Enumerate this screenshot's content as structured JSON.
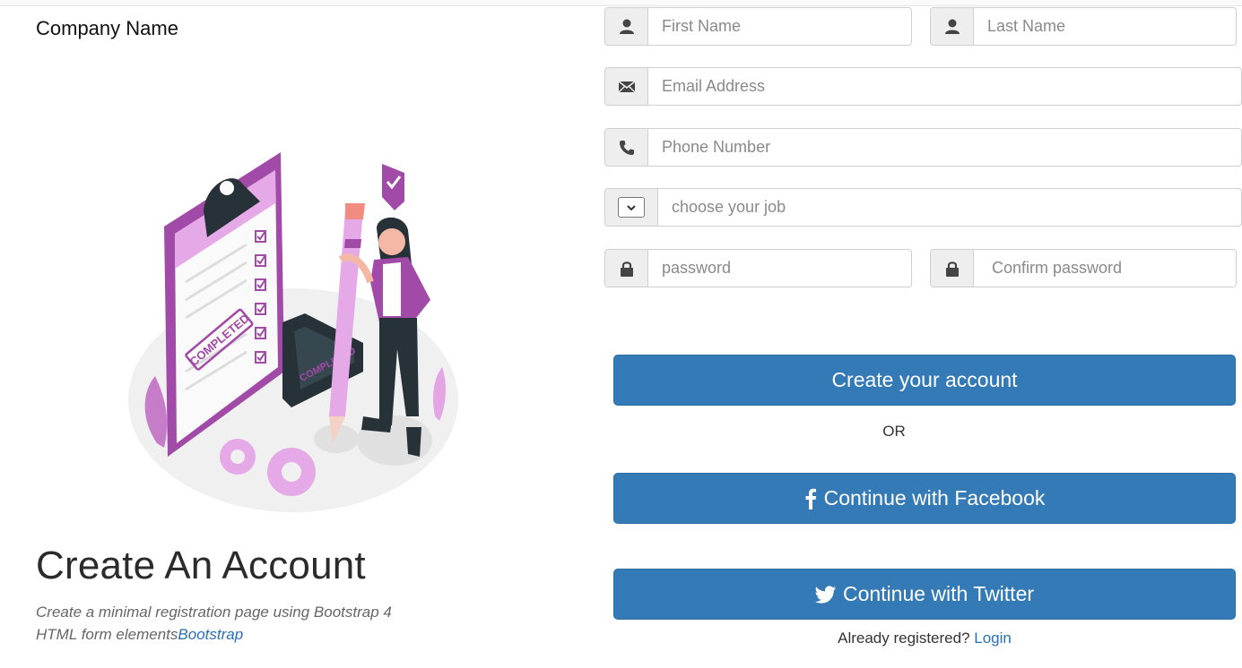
{
  "brand": {
    "name": "Company Name"
  },
  "hero": {
    "title": "Create An Account",
    "subtitle": "Create a minimal registration page using Bootstrap 4 HTML form elements",
    "link_text": "Bootstrap",
    "illustration": {
      "stamp_text": "COMPLETED",
      "stamp_text_2": "COMPLETED"
    }
  },
  "form": {
    "first_name": {
      "placeholder": "First Name",
      "value": "",
      "icon": "user-icon"
    },
    "last_name": {
      "placeholder": "Last Name",
      "value": "",
      "icon": "user-icon"
    },
    "email": {
      "placeholder": "Email Address",
      "value": "",
      "icon": "envelope-icon"
    },
    "phone": {
      "placeholder": "Phone Number",
      "value": "",
      "icon": "phone-icon"
    },
    "job": {
      "placeholder": "choose your job",
      "value": "",
      "icon": "chevron-down-icon"
    },
    "password": {
      "placeholder": "password",
      "value": "",
      "icon": "lock-icon"
    },
    "confirm_password": {
      "placeholder": "Confirm password",
      "value": "",
      "icon": "lock-icon"
    }
  },
  "actions": {
    "create_label": "Create your account",
    "or_label": "OR",
    "facebook_label": "Continue with Facebook",
    "twitter_label": "Continue with Twitter",
    "already_registered": "Already registered?",
    "login_label": "Login"
  },
  "colors": {
    "primary": "#337ab7",
    "link": "#2a6fb8",
    "illustration_accent": "#a24aa8",
    "illustration_dark": "#263238"
  }
}
